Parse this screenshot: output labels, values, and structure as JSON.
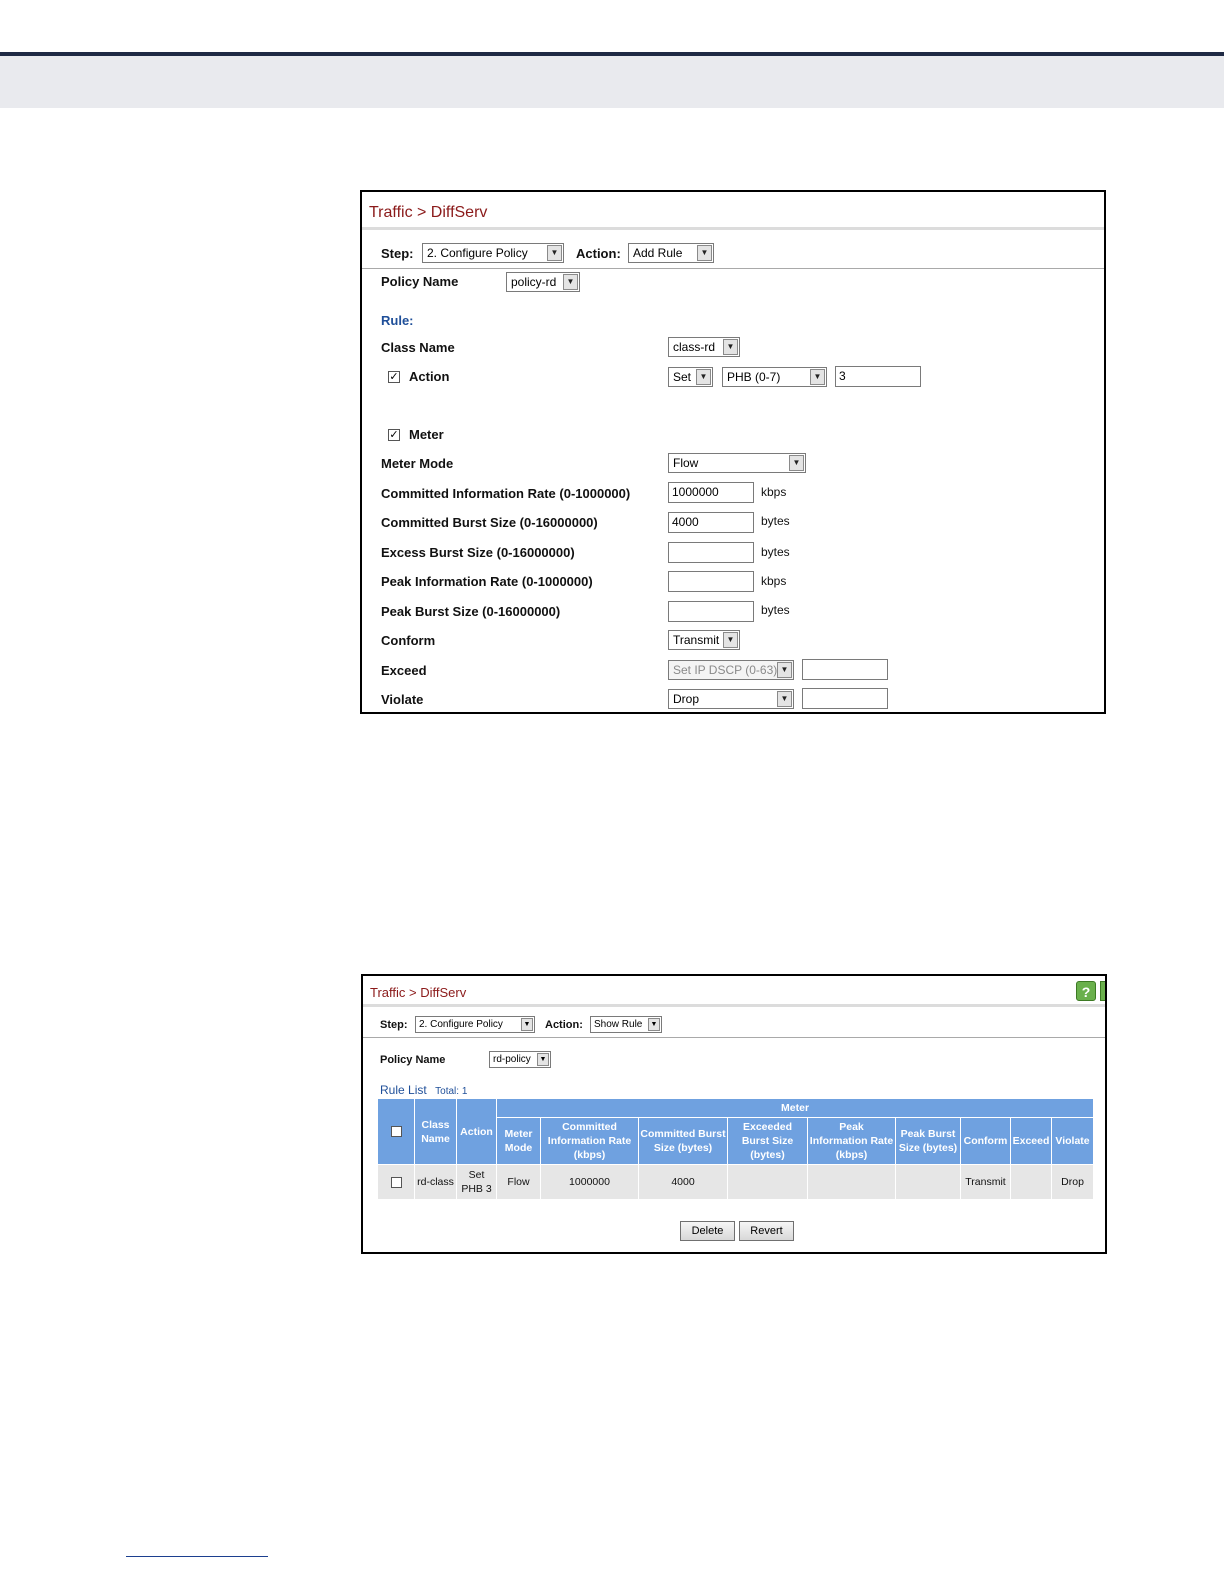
{
  "panel1": {
    "title": "Traffic > DiffServ",
    "step_label": "Step:",
    "step_value": "2. Configure Policy",
    "action_label": "Action:",
    "action_value": "Add Rule",
    "policy_name_label": "Policy Name",
    "policy_name_value": "policy-rd",
    "rule_header": "Rule:",
    "class_name_label": "Class Name",
    "class_name_value": "class-rd",
    "action_row_label": "Action",
    "action_set_value": "Set",
    "action_type_value": "PHB (0-7)",
    "action_input_value": "3",
    "meter_label": "Meter",
    "meter_mode_label": "Meter Mode",
    "meter_mode_value": "Flow",
    "cir_label": "Committed Information Rate (0-1000000)",
    "cir_value": "1000000",
    "cir_unit": "kbps",
    "cbs_label": "Committed Burst Size (0-16000000)",
    "cbs_value": "4000",
    "cbs_unit": "bytes",
    "ebs_label": "Excess Burst Size (0-16000000)",
    "ebs_value": "",
    "ebs_unit": "bytes",
    "pir_label": "Peak Information Rate (0-1000000)",
    "pir_value": "",
    "pir_unit": "kbps",
    "pbs_label": "Peak Burst Size (0-16000000)",
    "pbs_value": "",
    "pbs_unit": "bytes",
    "conform_label": "Conform",
    "conform_value": "Transmit",
    "exceed_label": "Exceed",
    "exceed_value": "Set IP DSCP (0-63)",
    "exceed_input": "",
    "violate_label": "Violate",
    "violate_value": "Drop",
    "violate_input": ""
  },
  "panel2": {
    "title": "Traffic > DiffServ",
    "help_icon": "?",
    "step_label": "Step:",
    "step_value": "2. Configure Policy",
    "action_label": "Action:",
    "action_value": "Show Rule",
    "policy_name_label": "Policy Name",
    "policy_name_value": "rd-policy",
    "rule_list_label": "Rule List",
    "rule_list_total": "Total: 1",
    "meter_group_header": "Meter",
    "headers": {
      "class_name": "Class Name",
      "action": "Action",
      "meter_mode": "Meter Mode",
      "cir": "Committed Information Rate (kbps)",
      "cbs": "Committed Burst Size (bytes)",
      "ebs": "Exceeded Burst Size (bytes)",
      "pir": "Peak Information Rate (kbps)",
      "pbs": "Peak Burst Size (bytes)",
      "conform": "Conform",
      "exceed": "Exceed",
      "violate": "Violate"
    },
    "rows": [
      {
        "class_name": "rd-class",
        "action": "Set PHB 3",
        "meter_mode": "Flow",
        "cir": "1000000",
        "cbs": "4000",
        "ebs": "",
        "pir": "",
        "pbs": "",
        "conform": "Transmit",
        "exceed": "",
        "violate": "Drop"
      }
    ],
    "delete_label": "Delete",
    "revert_label": "Revert"
  },
  "icons": {
    "dropdown": "▼",
    "check": "✓"
  }
}
